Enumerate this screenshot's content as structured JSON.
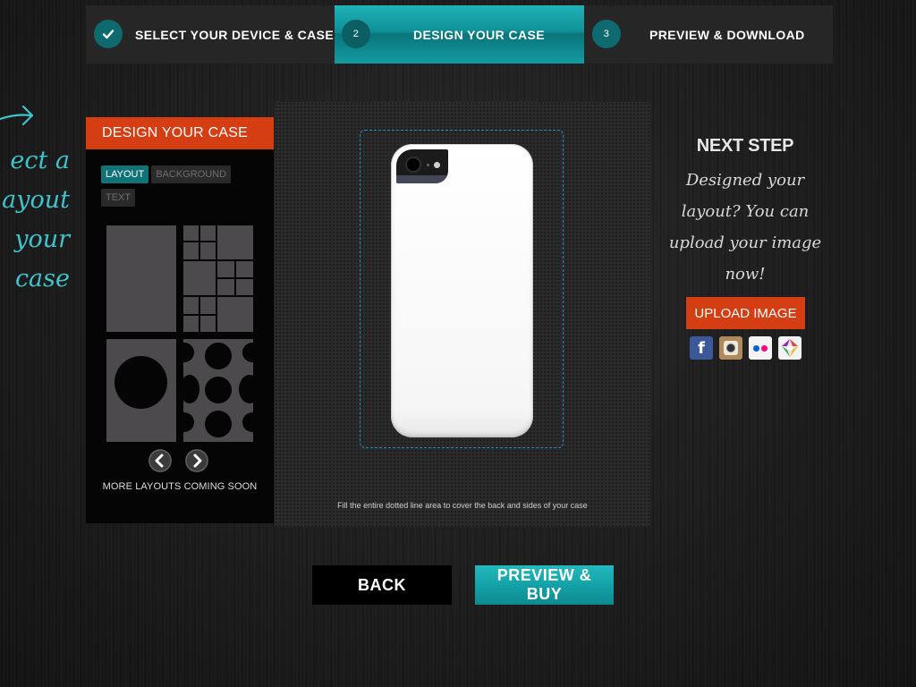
{
  "steps": [
    {
      "marker": "",
      "label": "SELECT YOUR DEVICE & CASE",
      "state": "done"
    },
    {
      "marker": "2",
      "label": "DESIGN YOUR CASE",
      "state": "active"
    },
    {
      "marker": "3",
      "label": "PREVIEW & DOWNLOAD",
      "state": "upcoming"
    }
  ],
  "chalk_hint": {
    "lines": [
      "ect a",
      "ayout",
      "your",
      "case"
    ],
    "color": "#3fc3cc"
  },
  "design_panel": {
    "title": "DESIGN YOUR CASE",
    "tabs": [
      {
        "label": "LAYOUT",
        "active": true
      },
      {
        "label": "BACKGROUND",
        "active": false
      },
      {
        "label": "TEXT",
        "active": false
      }
    ],
    "more_layouts": "MORE LAYOUTS COMING SOON"
  },
  "canvas": {
    "hint": "Fill the entire dotted line area to cover the back and sides of your case"
  },
  "next_step": {
    "title": "NEXT STEP",
    "text": "Designed your layout? You can upload your image now!",
    "upload_label": "UPLOAD IMAGE",
    "sources": [
      "facebook-icon",
      "instagram-icon",
      "flickr-icon",
      "picasa-icon"
    ]
  },
  "footer": {
    "back_label": "BACK",
    "buy_label": "PREVIEW & BUY"
  },
  "colors": {
    "accent_teal": "#13a2a8",
    "accent_orange": "#d43e12",
    "guide_blue": "#1e8ec0"
  }
}
